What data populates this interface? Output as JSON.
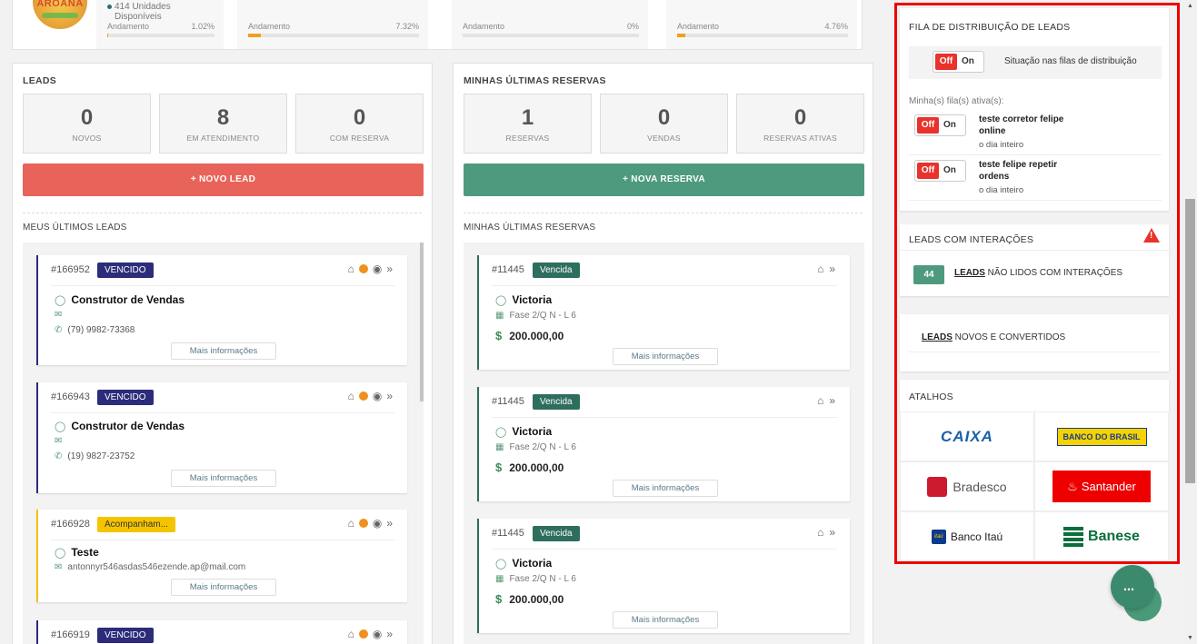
{
  "top_stats": {
    "logo_text": "AROANA",
    "units_line1": "414 Unidades",
    "units_line2": "Disponíveis",
    "columns": [
      {
        "label": "Andamento",
        "percent": "1.02%",
        "progress": 1.02
      },
      {
        "label": "Andamento",
        "percent": "7.32%",
        "progress": 7.32
      },
      {
        "label": "Andamento",
        "percent": "0%",
        "progress": 0
      },
      {
        "label": "Andamento",
        "percent": "4.76%",
        "progress": 4.76
      }
    ]
  },
  "leads": {
    "title": "LEADS",
    "counters": [
      {
        "num": "0",
        "label": "NOVOS"
      },
      {
        "num": "8",
        "label": "EM ATENDIMENTO"
      },
      {
        "num": "0",
        "label": "COM RESERVA"
      }
    ],
    "new_button": "+ NOVO LEAD",
    "list_title": "MEUS ÚLTIMOS LEADS",
    "cards": [
      {
        "id": "#166952",
        "badge": "VENCIDO",
        "name": "Construtor de Vendas",
        "email": "",
        "phone": "(79) 9982-73368",
        "more": "Mais informações"
      },
      {
        "id": "#166943",
        "badge": "VENCIDO",
        "name": "Construtor de Vendas",
        "email": "",
        "phone": "(19) 9827-23752",
        "more": "Mais informações"
      },
      {
        "id": "#166928",
        "badge": "Acompanham...",
        "name": "Teste",
        "email": "antonnyr546asdas546ezende.ap@mail.com",
        "phone": "",
        "more": "Mais informações"
      },
      {
        "id": "#166919",
        "badge": "VENCIDO"
      }
    ]
  },
  "reservas": {
    "title": "MINHAS ÚLTIMAS RESERVAS",
    "counters": [
      {
        "num": "1",
        "label": "RESERVAS"
      },
      {
        "num": "0",
        "label": "VENDAS"
      },
      {
        "num": "0",
        "label": "RESERVAS ATIVAS"
      }
    ],
    "new_button": "+ NOVA RESERVA",
    "list_title": "MINHAS ÚLTIMAS RESERVAS",
    "cards": [
      {
        "id": "#11445",
        "badge": "Vencida",
        "name": "Victoria",
        "phase": "Fase 2/Q N - L 6",
        "price": "200.000,00",
        "more": "Mais informações"
      },
      {
        "id": "#11445",
        "badge": "Vencida",
        "name": "Victoria",
        "phase": "Fase 2/Q N - L 6",
        "price": "200.000,00",
        "more": "Mais informações"
      },
      {
        "id": "#11445",
        "badge": "Vencida",
        "name": "Victoria",
        "phase": "Fase 2/Q N - L 6",
        "price": "200.000,00",
        "more": "Mais informações"
      }
    ]
  },
  "sidebar": {
    "queue_title": "FILA DE DISTRIBUIÇÃO DE LEADS",
    "toggle_off": "Off",
    "toggle_on": "On",
    "queue_status": "Situação nas filas de distribuição",
    "active_queues_label": "Minha(s) fila(s) ativa(s):",
    "queues": [
      {
        "name": "teste corretor felipe online",
        "time": "o dia inteiro"
      },
      {
        "name": "teste felipe repetir ordens",
        "time": "o dia inteiro"
      }
    ],
    "interactions_title": "LEADS COM INTERAÇÕES",
    "interactions_count": "44",
    "interactions_link": "LEADS",
    "interactions_text": " NÃO LIDOS COM INTERAÇÕES",
    "new_converted_link": "LEADS",
    "new_converted_text": " NOVOS E CONVERTIDOS",
    "shortcuts_title": "ATALHOS",
    "banks": [
      "CAIXA",
      "BANCO DO BRASIL",
      "Bradesco",
      "Santander",
      "Banco Itaú",
      "Banese"
    ]
  },
  "colors": {
    "lead_button": "#e8635a",
    "reserva_button": "#4e9a7e",
    "vencido_badge": "#2c2c7a",
    "acompanhamento_badge": "#f5c400",
    "vencida_badge": "#2e6e5e"
  }
}
